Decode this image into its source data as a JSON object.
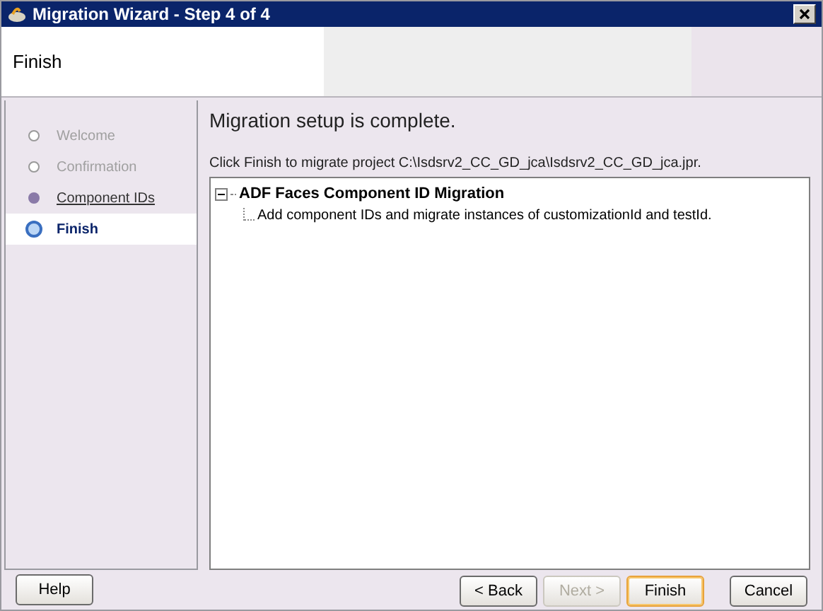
{
  "window": {
    "title": "Migration Wizard - Step 4 of 4"
  },
  "header": {
    "title": "Finish"
  },
  "steps": [
    {
      "label": "Welcome",
      "kind": "disabled",
      "selected": false
    },
    {
      "label": "Confirmation",
      "kind": "disabled",
      "selected": false
    },
    {
      "label": "Component IDs",
      "kind": "link",
      "selected": false
    },
    {
      "label": "Finish",
      "kind": "current",
      "selected": true
    }
  ],
  "content": {
    "heading": "Migration setup is complete.",
    "instruction": "Click Finish to migrate project C:\\Isdsrv2_CC_GD_jca\\Isdsrv2_CC_GD_jca.jpr.",
    "tree": [
      {
        "label": "ADF Faces Component ID Migration",
        "expanded": true,
        "children": [
          {
            "label": "Add component IDs and migrate instances of customizationId and testId."
          }
        ]
      }
    ]
  },
  "buttons": [
    {
      "label": "Help",
      "disabled": false,
      "default": false
    },
    {
      "label": "< Back",
      "disabled": false,
      "default": false
    },
    {
      "label": "Next >",
      "disabled": true,
      "default": false
    },
    {
      "label": "Finish",
      "disabled": false,
      "default": true
    },
    {
      "label": "Cancel",
      "disabled": false,
      "default": false
    }
  ]
}
